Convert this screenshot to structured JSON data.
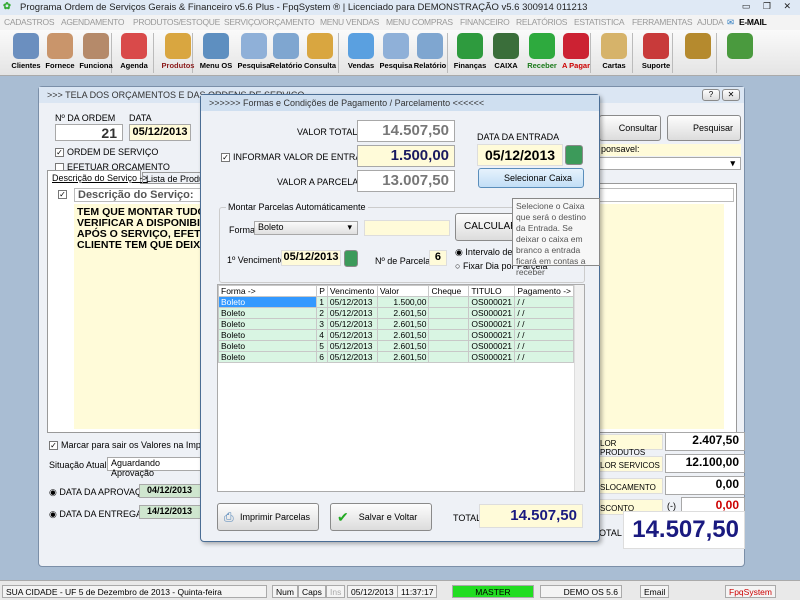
{
  "app": {
    "title": "Programa Ordem de Serviços Gerais & Financeiro v5.6 Plus - FpqSystem ® | Licenciado para  DEMONSTRAÇÃO v5.6 300914 011213"
  },
  "menu": [
    "CADASTROS",
    "AGENDAMENTO",
    "PRODUTOS/ESTOQUE",
    "SERVIÇO/ORÇAMENTO",
    "MENU VENDAS",
    "MENU COMPRAS",
    "FINANCEIRO",
    "RELATÓRIOS",
    "ESTATISTICA",
    "FERRAMENTAS",
    "AJUDA",
    "E-MAIL"
  ],
  "toolbar": [
    "Clientes",
    "Fornece",
    "Funciona",
    "Agenda",
    "Produtos",
    "Menu OS",
    "Pesquisa",
    "Relatório",
    "Consulta",
    "Vendas",
    "Pesquisa",
    "Relatório",
    "Finanças",
    "CAIXA",
    "Receber",
    "A Pagar",
    "Cartas",
    "Suporte",
    "",
    ""
  ],
  "back": {
    "title": ">>>  TELA DOS ORÇAMENTOS E DAS ORDENS DE SERVIÇO",
    "ordem_label": "Nº DA ORDEM",
    "ordem": "21",
    "data_label": "DATA",
    "data": "05/12/2013",
    "os_label": "ORDEM DE SERVIÇO",
    "orc_label": "EFETUAR ORÇAMENTO",
    "consultar": "Consultar",
    "pesquisar": "Pesquisar",
    "responsavel": "ponsavel:",
    "tab1": "Descrição do Serviço ->",
    "tab2": "Lista de Produtos",
    "desc_label": "Descrição do Serviço:",
    "desc": [
      "TEM QUE MONTAR TUDO",
      "VERIFICAR A DISPONIBILI",
      "APÓS O SERVIÇO, EFETU",
      "CLIENTE TEM QUE DEIXA"
    ],
    "marcar": "Marcar para sair os Valores na Impressão",
    "situacao_label": "Situação Atual",
    "situacao": "Aguardando Aprovação",
    "aprov_label": "DATA DA APROVAÇÃO",
    "aprov": "04/12/2013",
    "entrega_label": "DATA DA ENTREGA",
    "entrega": "14/12/2013",
    "vp_label": "LOR PRODUTOS",
    "vp": "2.407,50",
    "vs_label": "LOR SERVICOS",
    "vs": "12.100,00",
    "desl_label": "SLOCAMENTO",
    "desl": "0,00",
    "desc_v_label": "SCONTO",
    "minus": "(-)",
    "desconto": "0,00",
    "total_label": "OTAL",
    "total": "14.507,50"
  },
  "modal": {
    "title": ">>>>>> Formas e Condições de Pagamento / Parcelamento  <<<<<<",
    "valor_total_label": "VALOR TOTAL",
    "valor_total": "14.507,50",
    "entrada_label": "INFORMAR VALOR DE ENTRADA",
    "entrada": "1.500,00",
    "parcelar_label": "VALOR A PARCELAR",
    "parcelar": "13.007,50",
    "data_entrada_label": "DATA DA ENTRADA",
    "data_entrada": "05/12/2013",
    "selecionar_caixa": "Selecionar Caixa",
    "group": "Montar Parcelas Automáticamente",
    "forma_label": "Forma:",
    "forma": "Boleto",
    "calcular": "CALCULAR  P",
    "venc_label": "1º Vencimento:",
    "venc": "05/12/2013",
    "nparc_label": "Nº de Parcelas",
    "nparc": "6",
    "radio1": "Intervalo de D",
    "radio2": "Fixar Dia por Parcela",
    "columns": [
      "Forma ->",
      "P",
      "Vencimento",
      "Valor",
      "Cheque",
      "TITULO",
      "Pagamento ->"
    ],
    "rows": [
      [
        "Boleto",
        "1",
        "05/12/2013",
        "1.500,00",
        "",
        "OS000021",
        "/ /"
      ],
      [
        "Boleto",
        "2",
        "05/12/2013",
        "2.601,50",
        "",
        "OS000021",
        "/ /"
      ],
      [
        "Boleto",
        "3",
        "05/12/2013",
        "2.601,50",
        "",
        "OS000021",
        "/ /"
      ],
      [
        "Boleto",
        "4",
        "05/12/2013",
        "2.601,50",
        "",
        "OS000021",
        "/ /"
      ],
      [
        "Boleto",
        "5",
        "05/12/2013",
        "2.601,50",
        "",
        "OS000021",
        "/ /"
      ],
      [
        "Boleto",
        "6",
        "05/12/2013",
        "2.601,50",
        "",
        "OS000021",
        "/ /"
      ]
    ],
    "imprimir": "Imprimir Parcelas",
    "salvar": "Salvar e Voltar",
    "total_label": "TOTAL",
    "total": "14.507,50"
  },
  "tooltip": "Selecione o Caixa que será o destino da Entrada. Se deixar o caixa em branco a entrada ficará em contas a receber",
  "status": {
    "city": "SUA CIDADE - UF  5 de Dezembro de 2013 - Quinta-feira",
    "num": "Num",
    "caps": "Caps",
    "ins": "Ins",
    "date": "05/12/2013",
    "time": "11:37:17",
    "user": "MASTER",
    "demo": "DEMO OS 5.6",
    "email": "Email",
    "brand": "FpqSystem"
  },
  "colors": {
    "accent_blue": "#1a1a80",
    "negative": "#cc0000",
    "master_green": "#22dd22",
    "grid_row": "#d9f5e3"
  }
}
